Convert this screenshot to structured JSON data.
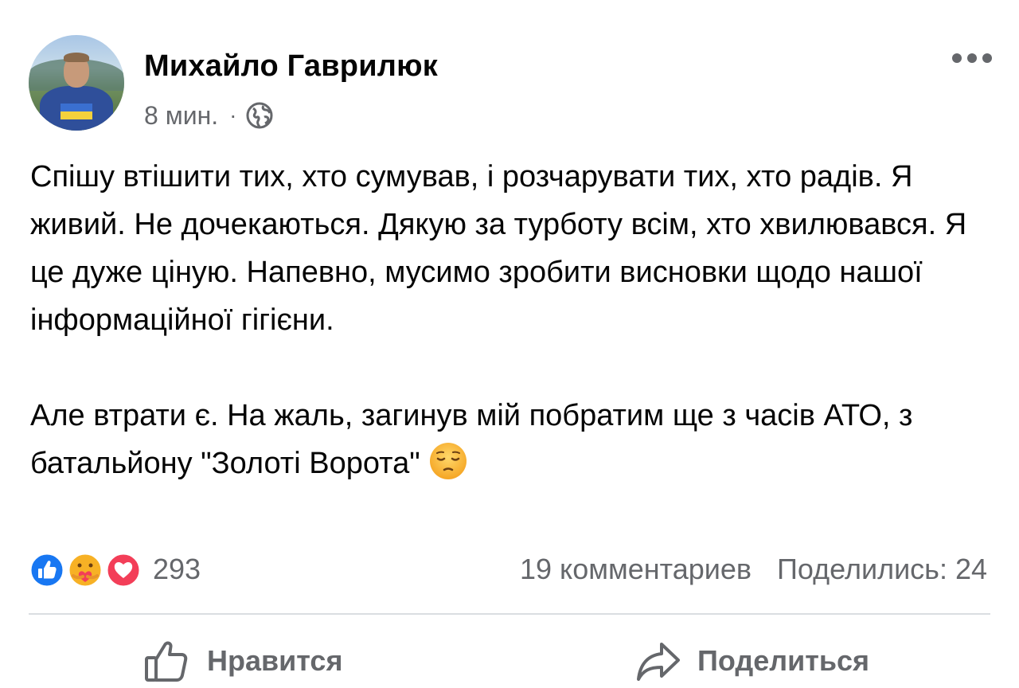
{
  "post": {
    "author": "Михайло Гаврилюк",
    "time": "8 мин.",
    "separator": "·",
    "privacy_icon": "globe-icon",
    "more_icon": "more-dots-icon",
    "text": {
      "paragraph1": "Спішу втішити тих, хто сумував, і розчарувати тих, хто радів. Я живий. Не дочекаються. Дякую за турботу всім, хто хвилювався. Я це дуже ціную. Напевно, мусимо зробити висновки щодо нашої інформаційної гігієни.",
      "paragraph2": "Але втрати є. На жаль, загинув мій побратим ще з часів АТО, з батальйону \"Золоті Ворота\"",
      "emoji": "pensive-face-emoji"
    },
    "reactions": {
      "icons": [
        "like-icon",
        "care-icon",
        "love-icon"
      ],
      "count": "293"
    },
    "comments": "19 комментариев",
    "shares": "Поделились: 24",
    "actions": {
      "like_label": "Нравится",
      "share_label": "Поделиться"
    },
    "colors": {
      "text": "#050505",
      "secondary": "#65676b",
      "like_blue": "#1877f2",
      "love_red": "#f33e58",
      "care_yellow": "#f7b125",
      "divider": "#dadde1"
    }
  }
}
